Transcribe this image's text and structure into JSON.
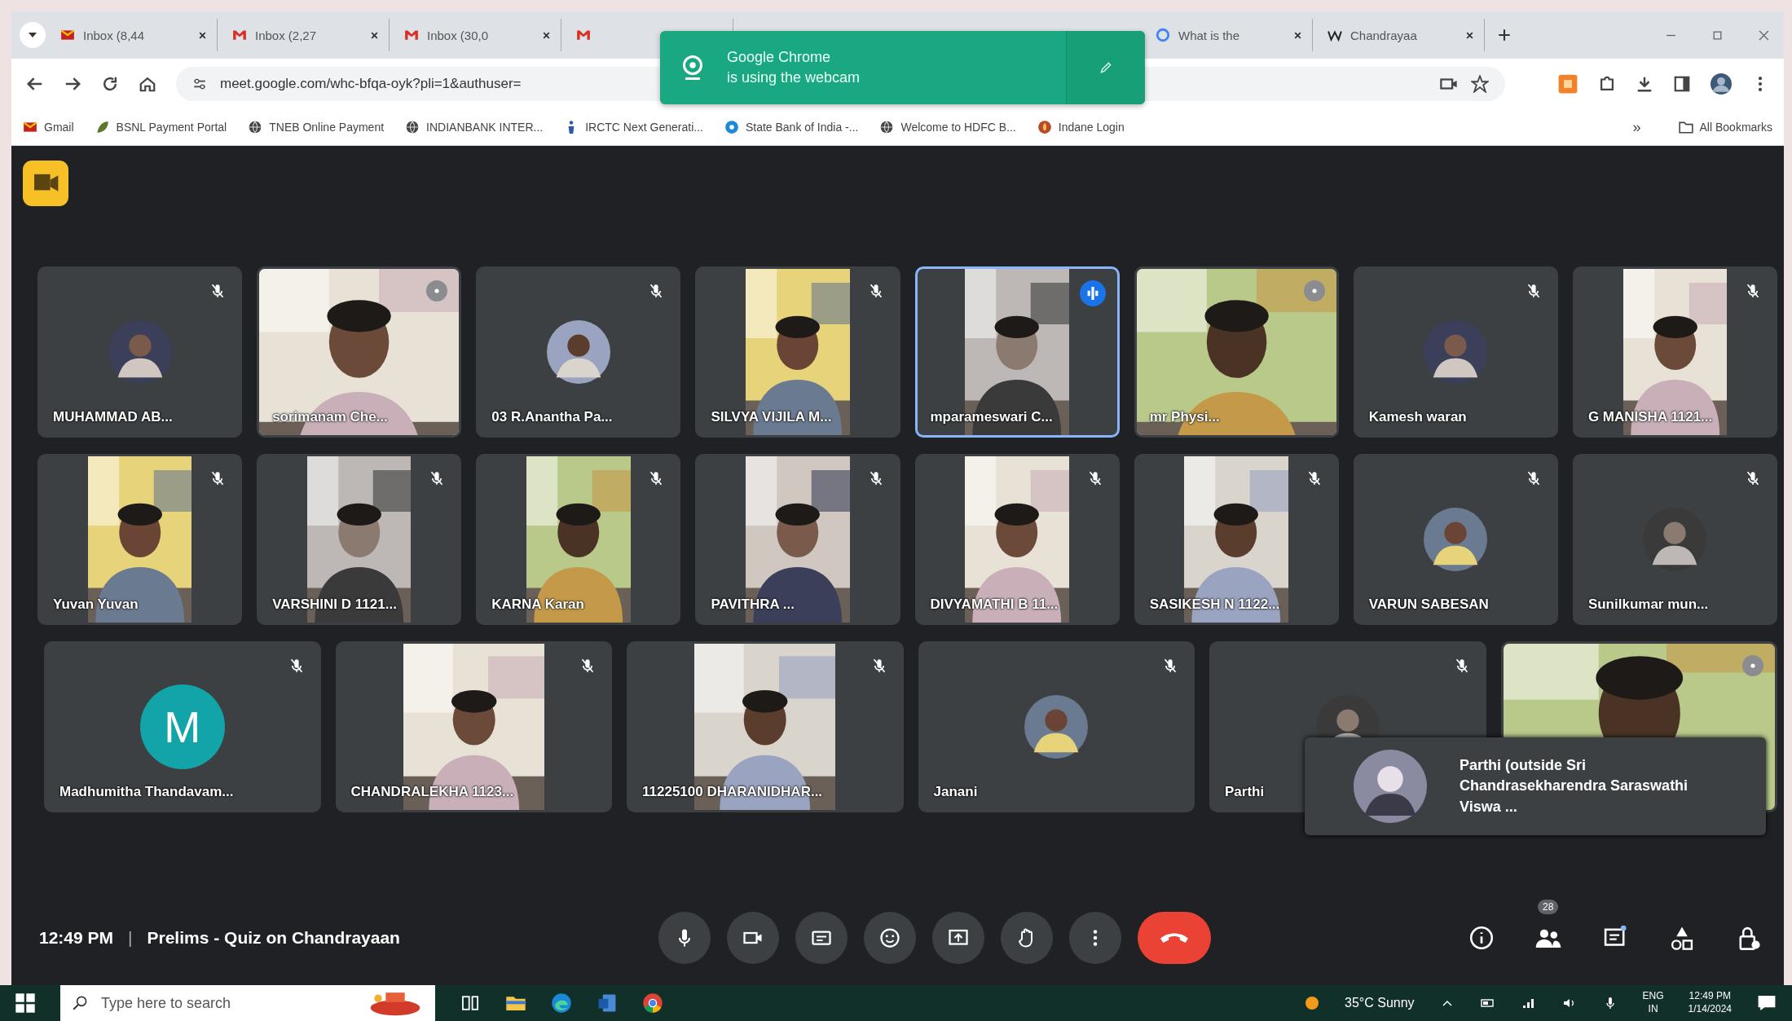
{
  "browser": {
    "tabs": [
      {
        "label": "Inbox (8,44",
        "kind": "mail-alt"
      },
      {
        "label": "Inbox (2,27",
        "kind": "mail"
      },
      {
        "label": "Inbox (30,0",
        "kind": "mail"
      },
      {
        "kind": "mail"
      },
      {
        "label": "What is the",
        "kind": "google"
      },
      {
        "label": "Chandrayaa",
        "kind": "wiki"
      }
    ],
    "address": "meet.google.com/whc-bfqa-oyk?pli=1&authuser=",
    "bookmarks": [
      {
        "label": "Gmail",
        "kind": "mail"
      },
      {
        "label": "BSNL Payment Portal",
        "kind": "leaf"
      },
      {
        "label": "TNEB Online Payment",
        "kind": "globe"
      },
      {
        "label": "INDIANBANK INTER...",
        "kind": "globe"
      },
      {
        "label": "IRCTC Next Generati...",
        "kind": "person"
      },
      {
        "label": "State Bank of India -...",
        "kind": "dot"
      },
      {
        "label": "Welcome to HDFC B...",
        "kind": "globe"
      },
      {
        "label": "Indane Login",
        "kind": "flame"
      }
    ],
    "more_bookmarks": "»",
    "all_bookmarks": "All Bookmarks"
  },
  "toast": {
    "line1": "Google Chrome",
    "line2": "is using the webcam"
  },
  "meeting": {
    "tile_rows": [
      {
        "tiles": [
          {
            "name": "MUHAMMAD AB...",
            "kind": "avatar",
            "muted": true,
            "speaking": false
          },
          {
            "name": "sorimanam Che...",
            "kind": "video",
            "muted": false,
            "speaking": false
          },
          {
            "name": "03 R.Anantha Pa...",
            "kind": "avatar",
            "muted": true,
            "speaking": false
          },
          {
            "name": "SILVYA VIJILA M...",
            "kind": "portrait-video",
            "muted": true,
            "speaking": false
          },
          {
            "name": "mparameswari C...",
            "kind": "portrait-video",
            "muted": false,
            "speaking": true
          },
          {
            "name": "mr Physi...",
            "kind": "video",
            "muted": false,
            "speaking": false
          },
          {
            "name": "Kamesh waran",
            "kind": "avatar",
            "muted": true,
            "speaking": false
          },
          {
            "name": "G MANISHA 1121...",
            "kind": "portrait-video",
            "muted": true,
            "speaking": false
          }
        ]
      },
      {
        "tiles": [
          {
            "name": "Yuvan Yuvan",
            "kind": "portrait-video",
            "muted": true,
            "speaking": false
          },
          {
            "name": "VARSHINI D 1121...",
            "kind": "portrait-video",
            "muted": true,
            "speaking": false
          },
          {
            "name": "KARNA Karan",
            "kind": "portrait-video",
            "muted": true,
            "speaking": false
          },
          {
            "name": "PAVITHRA ...",
            "kind": "portrait-video",
            "muted": true,
            "speaking": false
          },
          {
            "name": "DIVYAMATHI B 11...",
            "kind": "portrait-video",
            "muted": true,
            "speaking": false
          },
          {
            "name": "SASIKESH N 1122...",
            "kind": "portrait-video",
            "muted": true,
            "speaking": false
          },
          {
            "name": "VARUN SABESAN",
            "kind": "avatar",
            "muted": true,
            "speaking": false
          },
          {
            "name": "Sunilkumar mun...",
            "kind": "avatar",
            "muted": true,
            "speaking": false
          }
        ]
      },
      {
        "tiles": [
          {
            "name": "Madhumitha Thandavam...",
            "kind": "letter",
            "letter": "M",
            "muted": true,
            "speaking": false
          },
          {
            "name": "CHANDRALEKHA 1123...",
            "kind": "portrait-video",
            "muted": true,
            "speaking": false
          },
          {
            "name": "11225100 DHARANIDHAR...",
            "kind": "portrait-video",
            "muted": true,
            "speaking": false
          },
          {
            "name": "Janani",
            "kind": "avatar",
            "muted": true,
            "speaking": false
          },
          {
            "name": "Parthi",
            "kind": "avatar",
            "muted": true,
            "speaking": false
          },
          {
            "kind": "video",
            "muted": false,
            "speaking": false
          }
        ]
      }
    ],
    "self_view": {
      "name": "Parthi (outside Sri Chandrasekharendra Saraswathi Viswa ..."
    },
    "time": "12:49 PM",
    "separator": "|",
    "title": "Prelims - Quiz on Chandrayaan",
    "people_count": "28"
  },
  "taskbar": {
    "search_placeholder": "Type here to search",
    "weather": "35°C Sunny",
    "language": "ENG",
    "region": "IN",
    "clock_time": "12:49 PM",
    "clock_date": "1/14/2024"
  }
}
